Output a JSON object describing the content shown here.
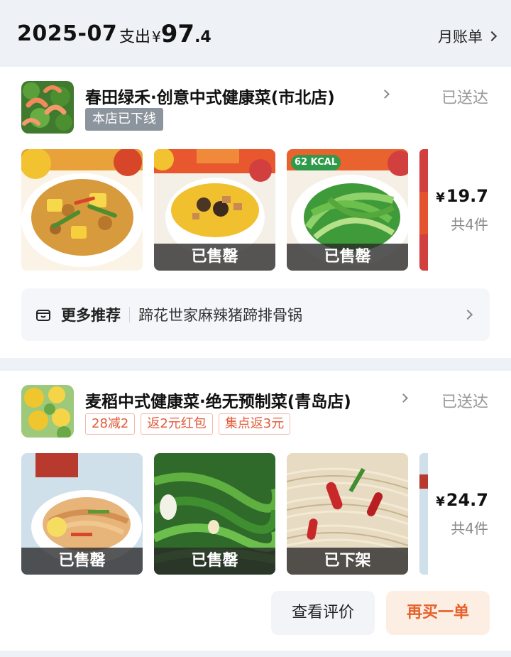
{
  "header": {
    "month": "2025-07",
    "spend_label": "支出",
    "currency": "¥",
    "spend_int": "97",
    "spend_dec": ".4",
    "bill_label": "月账单"
  },
  "orders": [
    {
      "store": "春田绿禾·创意中式健康菜(市北店)",
      "status": "已送达",
      "badge": "本店已下线",
      "dishes": [
        {
          "overlay": ""
        },
        {
          "overlay": "已售罄"
        },
        {
          "overlay": "已售罄",
          "kcal": "62 KCAL"
        }
      ],
      "currency": "¥",
      "price": "19.7",
      "count": "共4件",
      "recommend_label": "更多推荐",
      "recommend_text": "蹄花世家麻辣猪蹄排骨锅"
    },
    {
      "store": "麦稻中式健康菜·绝无预制菜(青岛店)",
      "status": "已送达",
      "tags": [
        "28减2",
        "返2元红包",
        "集点返3元"
      ],
      "dishes": [
        {
          "overlay": "已售罄"
        },
        {
          "overlay": "已售罄"
        },
        {
          "overlay": "已下架"
        }
      ],
      "currency": "¥",
      "price": "24.7",
      "count": "共4件",
      "review_button": "查看评价",
      "rebuy_button": "再买一单"
    }
  ],
  "colors": {
    "accent": "#e5622d",
    "tag_red": "#e35a3a",
    "muted": "#999999",
    "page_bg": "#eef1f5"
  }
}
